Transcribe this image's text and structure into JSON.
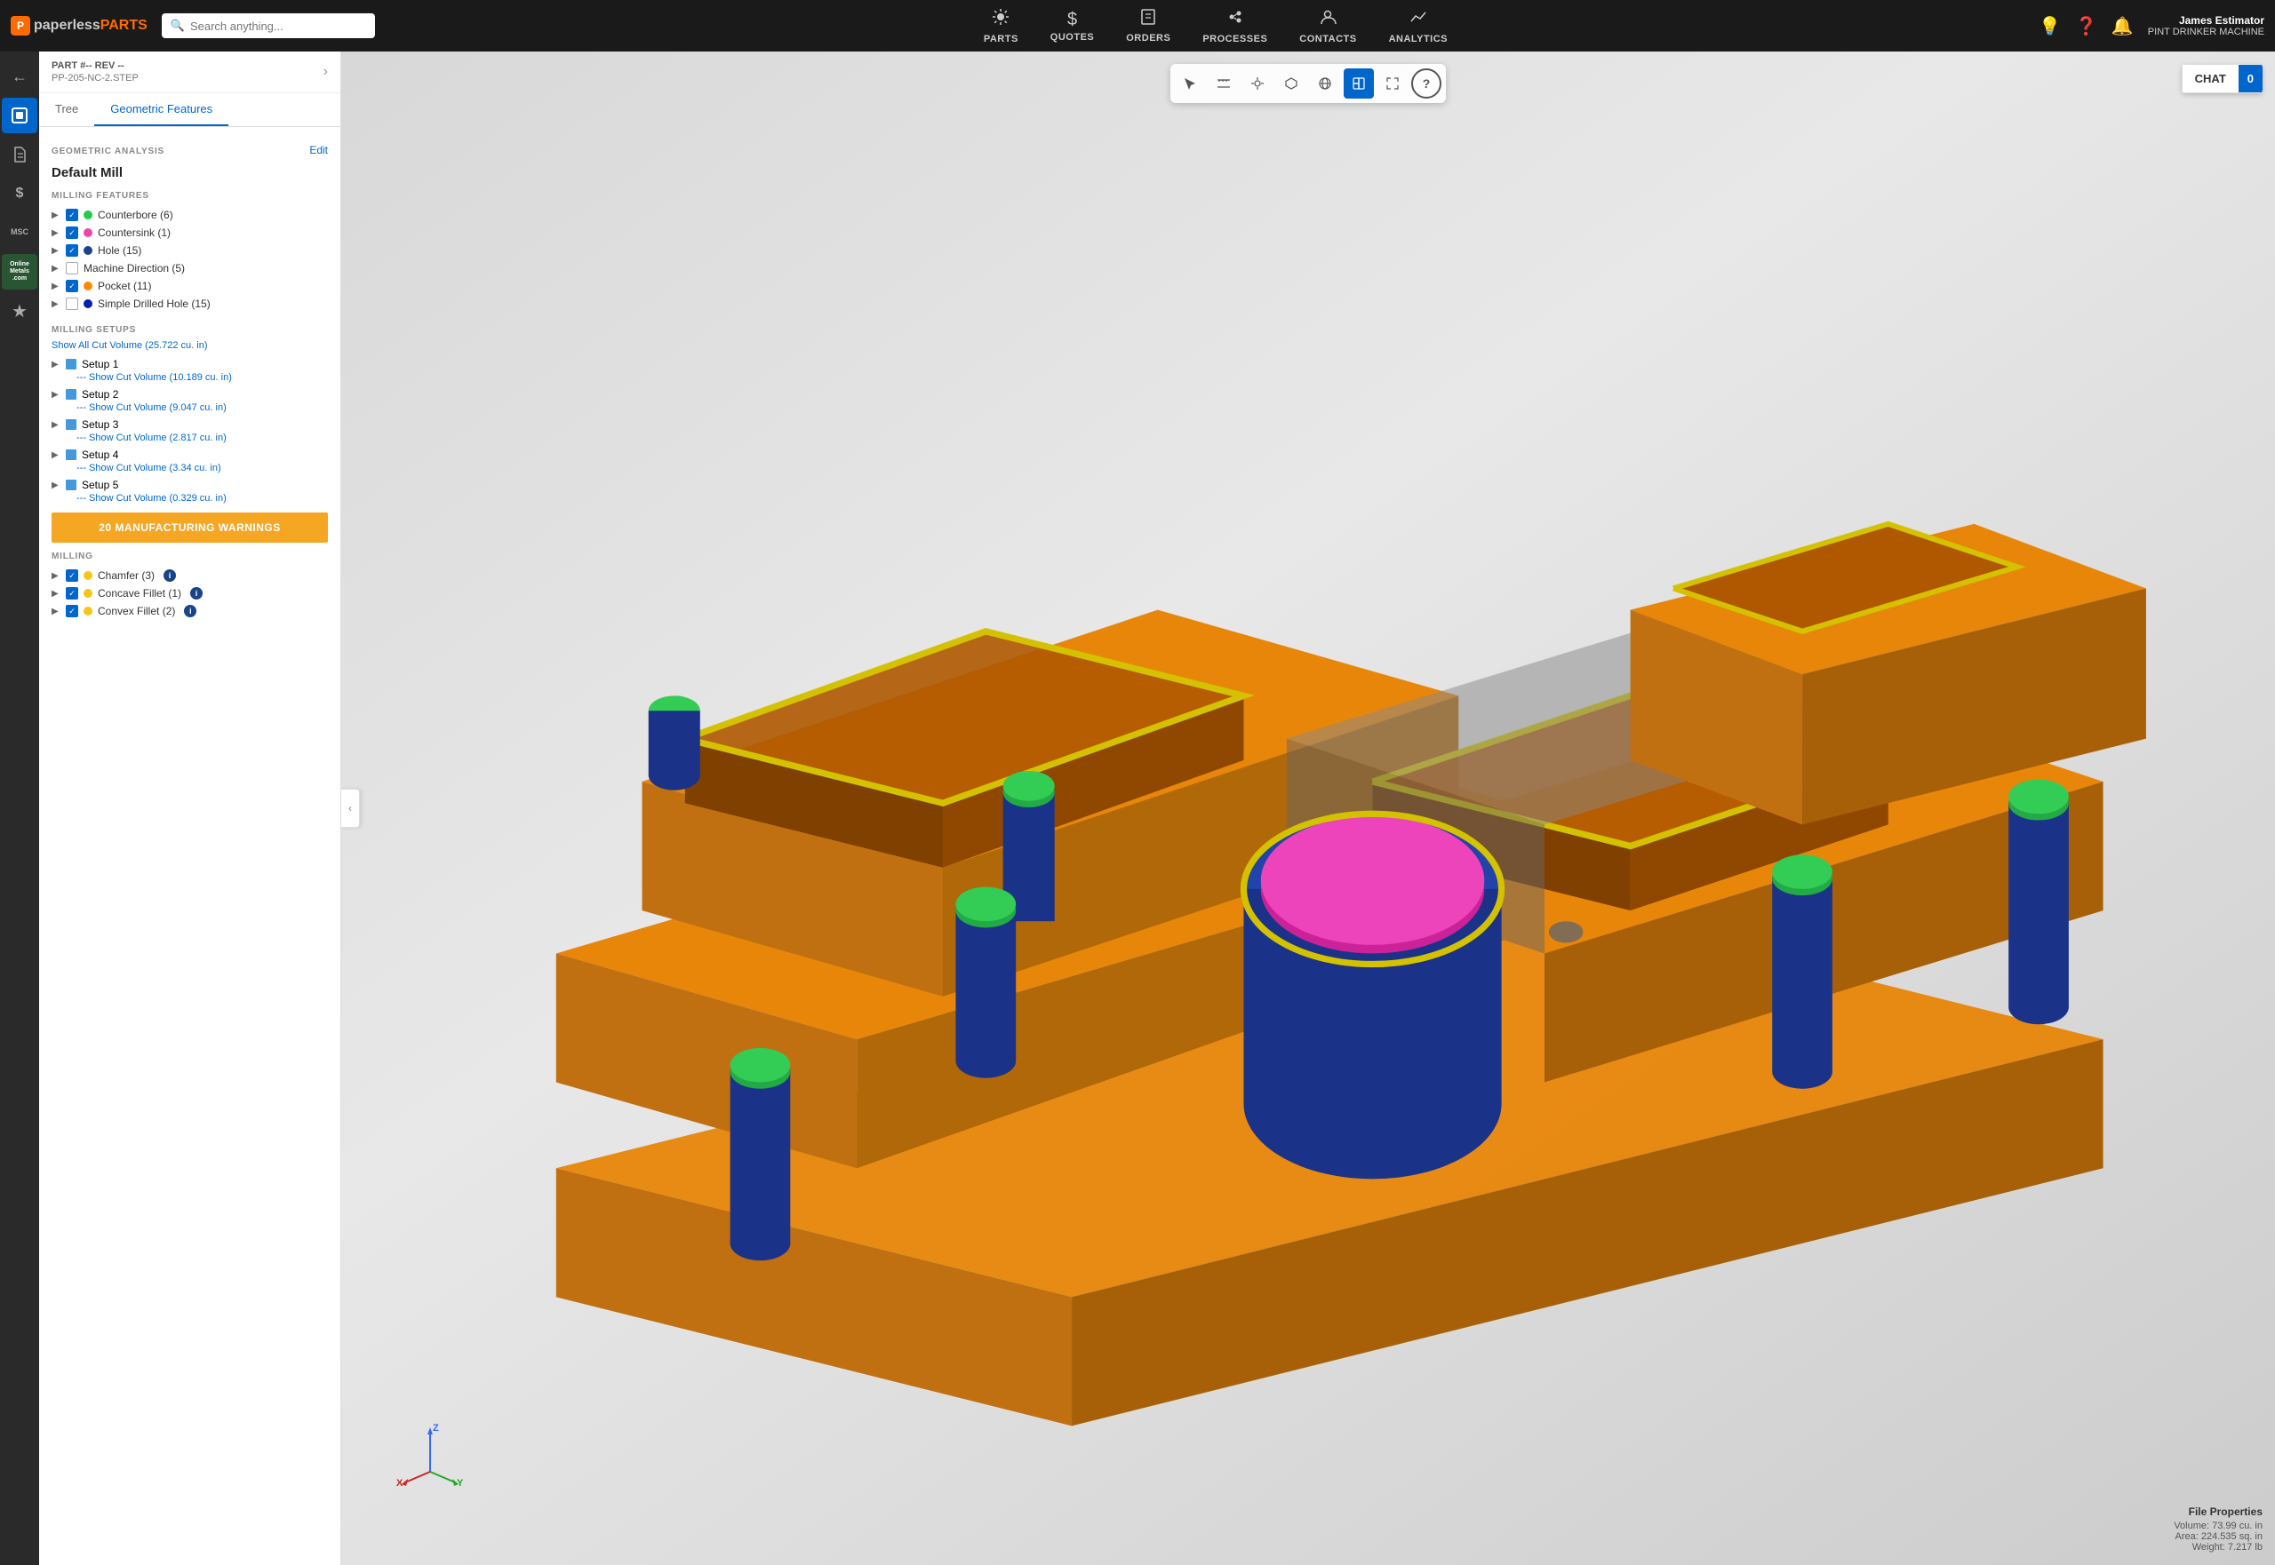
{
  "app": {
    "name_paperless": "paperless",
    "name_parts": "PARTS",
    "logo_char": "P"
  },
  "nav": {
    "search_placeholder": "Search anything...",
    "items": [
      {
        "id": "parts",
        "icon": "⚙️",
        "label": "PARTS",
        "active": false
      },
      {
        "id": "quotes",
        "icon": "💲",
        "label": "QUOTES",
        "active": false
      },
      {
        "id": "orders",
        "icon": "📋",
        "label": "ORDERS",
        "active": false
      },
      {
        "id": "processes",
        "icon": "⚙",
        "label": "PROCESSES",
        "active": false
      },
      {
        "id": "contacts",
        "icon": "👤",
        "label": "CONTACTS",
        "active": false
      },
      {
        "id": "analytics",
        "icon": "📈",
        "label": "ANALYTICS",
        "active": false
      }
    ],
    "user_name": "James Estimator",
    "user_company": "PINT DRINKER MACHINE"
  },
  "sidebar": {
    "items": [
      {
        "id": "back",
        "icon": "←"
      },
      {
        "id": "parts",
        "icon": "◻",
        "active": true
      },
      {
        "id": "file",
        "icon": "📄"
      },
      {
        "id": "money",
        "icon": "$"
      },
      {
        "id": "msc",
        "icon": "MSC"
      },
      {
        "id": "online-metals",
        "icon": "OM"
      },
      {
        "id": "star",
        "icon": "★"
      }
    ]
  },
  "left_panel": {
    "part_num": "PART #-- REV --",
    "part_file": "PP-205-NC-2.STEP",
    "tabs": [
      {
        "id": "tree",
        "label": "Tree",
        "active": false
      },
      {
        "id": "geometric",
        "label": "Geometric Features",
        "active": true
      }
    ],
    "geometric_analysis": {
      "section_label": "GEOMETRIC ANALYSIS",
      "edit_label": "Edit",
      "title": "Default Mill"
    },
    "milling_features": {
      "section_label": "MILLING FEATURES",
      "items": [
        {
          "id": "counterbore",
          "label": "Counterbore (6)",
          "checked": true,
          "dot_color": "green"
        },
        {
          "id": "countersink",
          "label": "Countersink (1)",
          "checked": true,
          "dot_color": "pink"
        },
        {
          "id": "hole",
          "label": "Hole (15)",
          "checked": true,
          "dot_color": "blue"
        },
        {
          "id": "machine-direction",
          "label": "Machine Direction (5)",
          "checked": false,
          "dot_color": null
        },
        {
          "id": "pocket",
          "label": "Pocket (11)",
          "checked": true,
          "dot_color": "orange"
        },
        {
          "id": "simple-drilled",
          "label": "Simple Drilled Hole (15)",
          "checked": false,
          "dot_color": "darkblue"
        }
      ]
    },
    "milling_setups": {
      "section_label": "MILLING SETUPS",
      "show_all": "Show All Cut Volume (25.722 cu. in)",
      "items": [
        {
          "id": "setup1",
          "label": "Setup 1",
          "volume": "--- Show Cut Volume (10.189 cu. in)"
        },
        {
          "id": "setup2",
          "label": "Setup 2",
          "volume": "--- Show Cut Volume (9.047 cu. in)"
        },
        {
          "id": "setup3",
          "label": "Setup 3",
          "volume": "--- Show Cut Volume (2.817 cu. in)"
        },
        {
          "id": "setup4",
          "label": "Setup 4",
          "volume": "--- Show Cut Volume (3.34 cu. in)"
        },
        {
          "id": "setup5",
          "label": "Setup 5",
          "volume": "--- Show Cut Volume (0.329 cu. in)"
        }
      ]
    },
    "warnings": {
      "label": "20 MANUFACTURING WARNINGS"
    },
    "milling_warnings": {
      "section_label": "MILLING",
      "items": [
        {
          "id": "chamfer",
          "label": "Chamfer (3)",
          "checked": true,
          "dot_color": "yellow",
          "has_info": true
        },
        {
          "id": "concave-fillet",
          "label": "Concave Fillet (1)",
          "checked": true,
          "dot_color": "yellow",
          "has_info": true
        },
        {
          "id": "convex-fillet",
          "label": "Convex Fillet (2)",
          "checked": true,
          "dot_color": "yellow",
          "has_info": true
        }
      ]
    }
  },
  "viewer": {
    "chat_label": "CHAT",
    "chat_count": "0",
    "toolbar_buttons": [
      {
        "id": "select",
        "icon": "↖",
        "active": false
      },
      {
        "id": "measure",
        "icon": "📐",
        "active": false
      },
      {
        "id": "explode",
        "icon": "💥",
        "active": false
      },
      {
        "id": "3d",
        "icon": "◻",
        "active": false
      },
      {
        "id": "globe",
        "icon": "🌐",
        "active": false
      },
      {
        "id": "cross-section",
        "icon": "✂",
        "active": true
      },
      {
        "id": "fullscreen",
        "icon": "⤢",
        "active": false
      }
    ],
    "help_icon": "?",
    "file_props": {
      "title": "File Properties",
      "volume": "Volume: 73.99 cu. in",
      "area": "Area: 224.535 sq. in",
      "weight": "Weight: 7.217 lb"
    }
  }
}
